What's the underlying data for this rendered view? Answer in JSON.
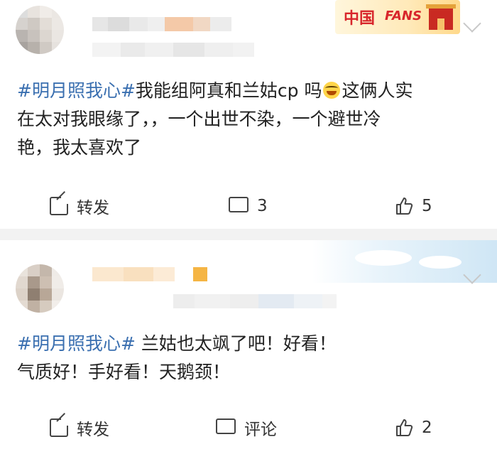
{
  "posts": [
    {
      "hashtag": "#明月照我心#",
      "text_before_emoji": "我能组阿真和兰姑cp 吗",
      "text_after_emoji": "这俩人实",
      "line2": "在太对我眼缘了，，一个出世不染，一个避世冷",
      "line3": "艳，我太喜欢了",
      "emoji_icon": "laughing-crying-emoji",
      "badge": {
        "cn": "中国",
        "en": "FANS"
      },
      "actions": {
        "repost": "转发",
        "comment": "3",
        "like": "5"
      }
    },
    {
      "hashtag": "#明月照我心#",
      "text": " 兰姑也太飒了吧！好看！",
      "line2": "气质好！手好看！天鹅颈！",
      "actions": {
        "repost": "转发",
        "comment": "评论",
        "like": "2"
      }
    }
  ],
  "colors": {
    "hashtag": "#3a6fb0",
    "text": "#222222",
    "divider": "#f2f2f2",
    "badge_red": "#d8262c"
  }
}
